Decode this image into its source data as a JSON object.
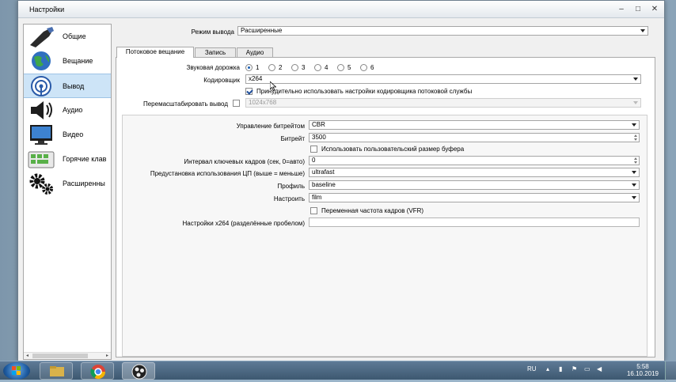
{
  "window": {
    "title": "Настройки",
    "min": "–",
    "max": "□",
    "close": "✕"
  },
  "sidebar": {
    "items": [
      {
        "label": "Общие",
        "icon": "wrench-icon"
      },
      {
        "label": "Вещание",
        "icon": "globe-icon"
      },
      {
        "label": "Вывод",
        "icon": "broadcast-icon"
      },
      {
        "label": "Аудио",
        "icon": "speaker-icon"
      },
      {
        "label": "Видео",
        "icon": "monitor-icon"
      },
      {
        "label": "Горячие клав",
        "icon": "keyboard-icon"
      },
      {
        "label": "Расширенны",
        "icon": "gears-icon"
      }
    ],
    "selected": 2
  },
  "output_mode": {
    "label": "Режим вывода",
    "value": "Расширенные"
  },
  "tabs": [
    "Потоковое вещание",
    "Запись",
    "Аудио"
  ],
  "stream": {
    "audio_track_label": "Звуковая дорожка",
    "tracks": [
      "1",
      "2",
      "3",
      "4",
      "5",
      "6"
    ],
    "selected_track": "1",
    "encoder_label": "Кодировщик",
    "encoder_value": "x264",
    "enforce_label": "Принудительно использовать настройки кодировщика потоковой службы",
    "rescale_label": "Перемасштабировать вывод",
    "rescale_value": "1024x768"
  },
  "encoder": {
    "rate_control_label": "Управление битрейтом",
    "rate_control_value": "CBR",
    "bitrate_label": "Битрейт",
    "bitrate_value": "3500",
    "custom_buffer_label": "Использовать пользовательский размер буфера",
    "keyframe_label": "Интервал ключевых кадров (сек, 0=авто)",
    "keyframe_value": "0",
    "preset_label": "Предустановка использования ЦП (выше = меньше)",
    "preset_value": "ultrafast",
    "profile_label": "Профиль",
    "profile_value": "baseline",
    "tune_label": "Настроить",
    "tune_value": "film",
    "vfr_label": "Переменная частота кадров (VFR)",
    "x264opts_label": "Настройки x264 (разделённые пробелом)",
    "x264opts_value": ""
  },
  "taskbar": {
    "lang": "RU",
    "time": "5:58",
    "date": "16.10.2019"
  },
  "colors": {
    "accent": "#1a5fb4",
    "selected_bg": "#cde4f7"
  }
}
